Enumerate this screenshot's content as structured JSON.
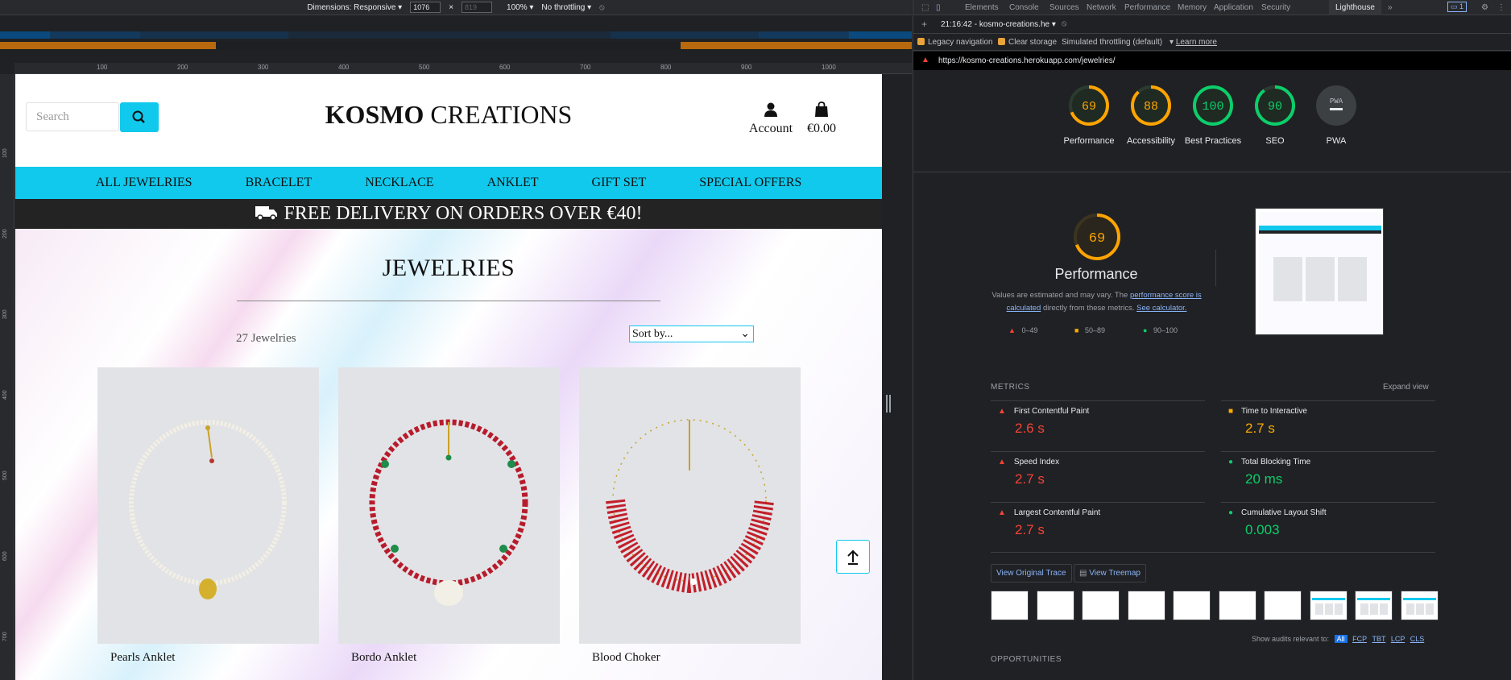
{
  "devtools_toolbar": {
    "dimensions_label": "Dimensions: Responsive ▾",
    "width": "1076",
    "height": "819",
    "times": "×",
    "zoom": "100% ▾",
    "throttling": "No throttling ▾"
  },
  "site": {
    "search_placeholder": "Search",
    "logo_bold": "KOSMO",
    "logo_rest": "CREATIONS",
    "account_label": "Account",
    "cart_total": "€0.00",
    "nav": [
      "ALL JEWELRIES",
      "BRACELET",
      "NECKLACE",
      "ANKLET",
      "GIFT SET",
      "SPECIAL OFFERS"
    ],
    "banner": "FREE DELIVERY ON ORDERS OVER €40!",
    "page_title": "JEWELRIES",
    "count_label": "27 Jewelries",
    "sort_value": "Sort by...",
    "products": [
      {
        "name": "Pearls Anklet"
      },
      {
        "name": "Bordo Anklet"
      },
      {
        "name": "Blood Choker"
      }
    ]
  },
  "ruler": {
    "h": [
      "100",
      "200",
      "300",
      "400",
      "500",
      "600",
      "700",
      "800",
      "900",
      "1000"
    ],
    "v": [
      "100",
      "200",
      "300",
      "400",
      "500",
      "600",
      "700"
    ]
  },
  "devtools": {
    "tabs": [
      "Elements",
      "Console",
      "Sources",
      "Network",
      "Performance",
      "Memory",
      "Application",
      "Security",
      "Lighthouse"
    ],
    "active_tab": "Lighthouse",
    "issues_count": "1",
    "report_label": "21:16:42 - kosmo-creations.he ▾",
    "legacy_nav": "Legacy navigation",
    "clear_storage": "Clear storage",
    "throttling": "Simulated throttling (default)",
    "learn_more": "Learn more",
    "url": "https://kosmo-creations.herokuapp.com/jewelries/",
    "scores": [
      {
        "label": "Performance",
        "value": "69",
        "color": "#ffa400",
        "fraction": 0.69
      },
      {
        "label": "Accessibility",
        "value": "88",
        "color": "#ffa400",
        "fraction": 0.88
      },
      {
        "label": "Best Practices",
        "value": "100",
        "color": "#0cce6b",
        "fraction": 1.0
      },
      {
        "label": "SEO",
        "value": "90",
        "color": "#0cce6b",
        "fraction": 0.9
      },
      {
        "label": "PWA",
        "value": "PWA",
        "color": "#9aa0a6",
        "fraction": 0
      }
    ],
    "perf_title": "Performance",
    "perf_score": "69",
    "perf_desc_1": "Values are estimated and may vary. The",
    "perf_link": "performance score is calculated",
    "perf_desc_2": "directly from these metrics.",
    "perf_calc": "See calculator.",
    "legend": [
      "0–49",
      "50–89",
      "90–100"
    ],
    "metrics_header": "METRICS",
    "expand_view": "Expand view",
    "metrics": [
      {
        "label": "First Contentful Paint",
        "value": "2.6 s",
        "status": "red"
      },
      {
        "label": "Time to Interactive",
        "value": "2.7 s",
        "status": "orange"
      },
      {
        "label": "Speed Index",
        "value": "2.7 s",
        "status": "red"
      },
      {
        "label": "Total Blocking Time",
        "value": "20 ms",
        "status": "green"
      },
      {
        "label": "Largest Contentful Paint",
        "value": "2.7 s",
        "status": "red"
      },
      {
        "label": "Cumulative Layout Shift",
        "value": "0.003",
        "status": "green"
      }
    ],
    "view_trace": "View Original Trace",
    "view_treemap": "View Treemap",
    "audits_label": "Show audits relevant to:",
    "audit_filters": [
      "All",
      "FCP",
      "TBT",
      "LCP",
      "CLS"
    ],
    "opportunities": "OPPORTUNITIES"
  }
}
